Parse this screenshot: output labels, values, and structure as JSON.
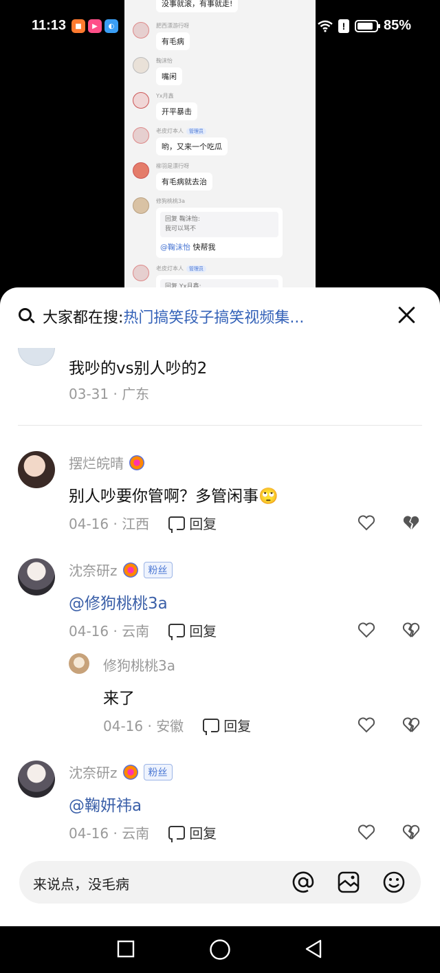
{
  "status_bar": {
    "time": "11:13",
    "battery": "85%",
    "battery_level": 0.85,
    "app_icons": [
      "taobao-icon",
      "video-icon",
      "browser-icon",
      "music-icon",
      "bilibili-icon"
    ]
  },
  "video_frame": {
    "messages": [
      {
        "name": "",
        "text": "没事就滚，有事就走!"
      },
      {
        "name": "肥西漂游行呀",
        "text": "有毛病"
      },
      {
        "name": "鞠沫怡",
        "text": "嘴闲"
      },
      {
        "name": "Yx月鑫",
        "text": "开平暴击"
      },
      {
        "name": "老皮灯本人",
        "tag": "管理员",
        "text": "哟，又来一个吃瓜"
      },
      {
        "name": "柳羽是漂行呀",
        "text": "有毛病就去治"
      },
      {
        "name": "修狗桃桃3a",
        "quote_line1": "回复 鞠沫怡:",
        "quote_line2": "我可以骂不",
        "at": "@鞠沫怡",
        "text": " 快帮我"
      },
      {
        "name": "老皮灯本人",
        "tag": "管理员",
        "quote_line1": "回复 Yx月鑫:"
      }
    ]
  },
  "sheet": {
    "search": {
      "label": "大家都在搜:",
      "term": "热门搞笑段子搞笑视频集..."
    },
    "post": {
      "text": "我吵的vs别人吵的2",
      "meta": "03-31 · 广东"
    },
    "reply_label": "回复",
    "comments": [
      {
        "name": "摆烂皖晴",
        "fan_tag": "",
        "text": "别人吵要你管啊？多管闲事🙄",
        "date": "04-16 · 江西",
        "at": false,
        "disliked": true
      },
      {
        "name": "沈奈研z",
        "fan_tag": "粉丝",
        "text": "@修狗桃桃3a",
        "date": "04-16 · 云南",
        "at": true,
        "disliked": false
      },
      {
        "name": "修狗桃桃3a",
        "fan_tag": "",
        "text": "来了",
        "date": "04-16 · 安徽",
        "at": false,
        "disliked": false
      },
      {
        "name": "沈奈研z",
        "fan_tag": "粉丝",
        "text": "@鞠妍祎a",
        "date": "04-16 · 云南",
        "at": true,
        "disliked": false
      }
    ],
    "input": {
      "placeholder": "来说点，没毛病"
    }
  },
  "colors": {
    "accent": "#3462b8",
    "mention": "#3a5fa8",
    "meta": "#999999"
  }
}
